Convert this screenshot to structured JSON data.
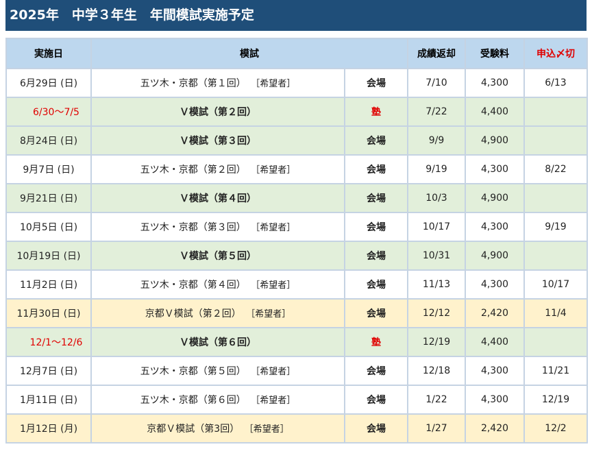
{
  "title": "2025年　中学３年生　年間模試実施予定",
  "headers": {
    "date": "実施日",
    "exam": "模試",
    "result": "成績返却",
    "fee": "受験料",
    "apply": "申込〆切"
  },
  "rows": [
    {
      "date": "6月29日 (日)",
      "exam": "五ツ木・京都（第１回）",
      "note": "［希望者］",
      "venue": "会場",
      "result": "7/10",
      "fee": "4,300",
      "deadline": "6/13"
    },
    {
      "date": "6/30〜7/5",
      "exam": "Ｖ模試（第２回）",
      "note": "",
      "venue": "塾",
      "result": "7/22",
      "fee": "4,400",
      "deadline": ""
    },
    {
      "date": "8月24日 (日)",
      "exam": "Ｖ模試（第３回）",
      "note": "",
      "venue": "会場",
      "result": "9/9",
      "fee": "4,900",
      "deadline": ""
    },
    {
      "date": "9月7日 (日)",
      "exam": "五ツ木・京都（第２回）",
      "note": "［希望者］",
      "venue": "会場",
      "result": "9/19",
      "fee": "4,300",
      "deadline": "8/22"
    },
    {
      "date": "9月21日 (日)",
      "exam": "Ｖ模試（第４回）",
      "note": "",
      "venue": "会場",
      "result": "10/3",
      "fee": "4,900",
      "deadline": ""
    },
    {
      "date": "10月5日 (日)",
      "exam": "五ツ木・京都（第３回）",
      "note": "［希望者］",
      "venue": "会場",
      "result": "10/17",
      "fee": "4,300",
      "deadline": "9/19"
    },
    {
      "date": "10月19日 (日)",
      "exam": "Ｖ模試（第５回）",
      "note": "",
      "venue": "会場",
      "result": "10/31",
      "fee": "4,900",
      "deadline": ""
    },
    {
      "date": "11月2日 (日)",
      "exam": "五ツ木・京都（第４回）",
      "note": "［希望者］",
      "venue": "会場",
      "result": "11/13",
      "fee": "4,300",
      "deadline": "10/17"
    },
    {
      "date": "11月30日 (日)",
      "exam": "京都Ｖ模試（第２回）",
      "note": "［希望者］",
      "venue": "会場",
      "result": "12/12",
      "fee": "2,420",
      "deadline": "11/4"
    },
    {
      "date": "12/1〜12/6",
      "exam": "Ｖ模試（第６回）",
      "note": "",
      "venue": "塾",
      "result": "12/19",
      "fee": "4,400",
      "deadline": ""
    },
    {
      "date": "12月7日 (日)",
      "exam": "五ツ木・京都（第５回）",
      "note": "［希望者］",
      "venue": "会場",
      "result": "12/18",
      "fee": "4,300",
      "deadline": "11/21"
    },
    {
      "date": "1月11日 (日)",
      "exam": "五ツ木・京都（第６回）",
      "note": "［希望者］",
      "venue": "会場",
      "result": "1/22",
      "fee": "4,300",
      "deadline": "12/19"
    },
    {
      "date": "1月12日 (月)",
      "exam": "京都Ｖ模試（第3回）",
      "note": "［希望者］",
      "venue": "会場",
      "result": "1/27",
      "fee": "2,420",
      "deadline": "12/2"
    }
  ]
}
